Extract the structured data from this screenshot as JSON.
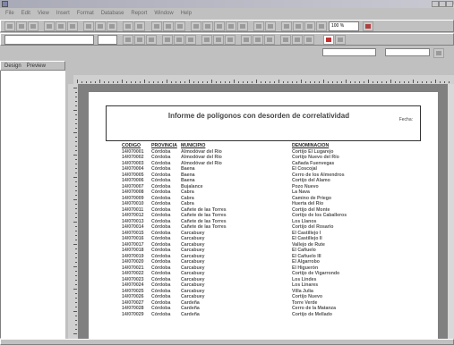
{
  "window": {
    "title": "",
    "min_label": "_",
    "max_label": "□",
    "close_label": "x"
  },
  "menu": {
    "items": [
      "File",
      "Edit",
      "View",
      "Insert",
      "Format",
      "Database",
      "Report",
      "Window",
      "Help"
    ]
  },
  "left_pane": {
    "tabs": [
      "Design",
      "Preview"
    ]
  },
  "zoom": "100 %",
  "report": {
    "title": "Informe de polígonos con desorden de correlatividad",
    "date_label": "Fecha:",
    "time_label": ""
  },
  "table": {
    "headers": [
      "CODIGO",
      "PROVINCIA",
      "MUNICIPIO",
      "DENOMINACION"
    ],
    "rows": [
      [
        "14/070001",
        "Córdoba",
        "Almodóvar del Río",
        "Cortijo El Lugarejo"
      ],
      [
        "14/070002",
        "Córdoba",
        "Almodóvar del Río",
        "Cortijo Nuevo del Río"
      ],
      [
        "14/070003",
        "Córdoba",
        "Almodóvar del Río",
        "Cañada Fuenvegas"
      ],
      [
        "14/070004",
        "Córdoba",
        "Baena",
        "El Coscojal"
      ],
      [
        "14/070005",
        "Córdoba",
        "Baena",
        "Cerro de los Almendros"
      ],
      [
        "14/070006",
        "Córdoba",
        "Baena",
        "Cortijo del Alamo"
      ],
      [
        "14/070007",
        "Córdoba",
        "Bujalance",
        "Pozo Nuevo"
      ],
      [
        "14/070008",
        "Córdoba",
        "Cabra",
        "La Nava"
      ],
      [
        "14/070009",
        "Córdoba",
        "Cabra",
        "Camino de Priego"
      ],
      [
        "14/070010",
        "Córdoba",
        "Cabra",
        "Huerta del Río"
      ],
      [
        "14/070011",
        "Córdoba",
        "Cañete de las Torres",
        "Cortijo del Monte"
      ],
      [
        "14/070012",
        "Córdoba",
        "Cañete de las Torres",
        "Cortijo de los Caballeros"
      ],
      [
        "14/070013",
        "Córdoba",
        "Cañete de las Torres",
        "Los Llanos"
      ],
      [
        "14/070014",
        "Córdoba",
        "Cañete de las Torres",
        "Cortijo del Rosario"
      ],
      [
        "14/070015",
        "Córdoba",
        "Carcabuey",
        "El Castillejo I"
      ],
      [
        "14/070016",
        "Córdoba",
        "Carcabuey",
        "El Castillejo II"
      ],
      [
        "14/070017",
        "Córdoba",
        "Carcabuey",
        "Vallejo de Rute"
      ],
      [
        "14/070018",
        "Córdoba",
        "Carcabuey",
        "El Cañuelo"
      ],
      [
        "14/070019",
        "Córdoba",
        "Carcabuey",
        "El Cañuelo III"
      ],
      [
        "14/070020",
        "Córdoba",
        "Carcabuey",
        "El Algarrobo"
      ],
      [
        "14/070021",
        "Córdoba",
        "Carcabuey",
        "El Higuerón"
      ],
      [
        "14/070022",
        "Córdoba",
        "Carcabuey",
        "Cortijo de Vigarrondo"
      ],
      [
        "14/070023",
        "Córdoba",
        "Carcabuey",
        "Los Lindes"
      ],
      [
        "14/070024",
        "Córdoba",
        "Carcabuey",
        "Los Linares"
      ],
      [
        "14/070025",
        "Córdoba",
        "Carcabuey",
        "Villa Julia"
      ],
      [
        "14/070026",
        "Córdoba",
        "Carcabuey",
        "Cortijo Nuevo"
      ],
      [
        "14/070027",
        "Córdoba",
        "Cardeña",
        "Torre Verde"
      ],
      [
        "14/070028",
        "Córdoba",
        "Cardeña",
        "Cerro de la Matanza"
      ],
      [
        "14/070029",
        "Córdoba",
        "Cardeña",
        "Cortijo de Mellado"
      ]
    ]
  },
  "status": {
    "left": "",
    "right": ""
  }
}
